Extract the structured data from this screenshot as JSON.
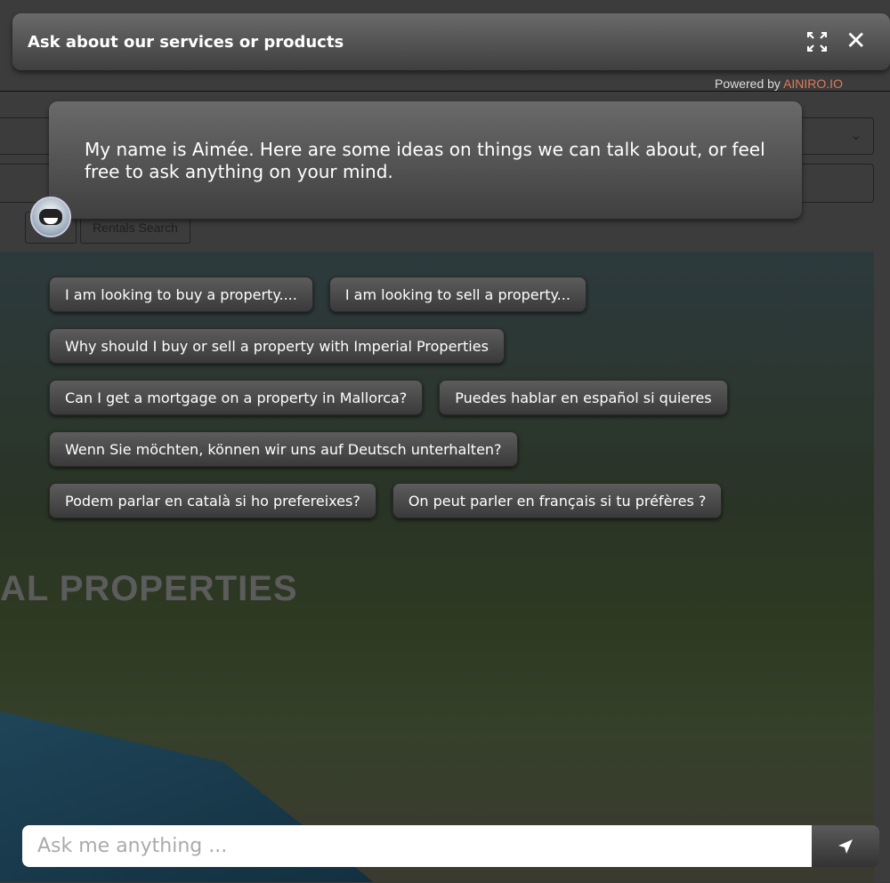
{
  "header": {
    "title": "Ask about our services or products",
    "maximize_icon": "maximize-icon",
    "close_icon": "close-icon"
  },
  "powered_by": {
    "prefix": "Powered by",
    "brand": "AINIRO.IO",
    "brand_color": "#e07a5a"
  },
  "background_site": {
    "button_label": "Rentals Search",
    "hero_title": "AL PROPERTIES"
  },
  "greeting": "My name is Aimée. Here are some ideas on things we can talk about, or feel free to ask anything on your mind.",
  "suggestions": [
    [
      "I am looking to buy a property....",
      "I am looking to sell a property..."
    ],
    [
      "Why should I buy or sell a property with Imperial Properties"
    ],
    [
      "Can I get a mortgage on a property in Mallorca?",
      "Puedes hablar en español si quieres"
    ],
    [
      "Wenn Sie möchten, können wir uns auf Deutsch unterhalten?"
    ],
    [
      "Podem parlar en català si ho prefereixes?",
      "On peut parler en français si tu préfères ?"
    ]
  ],
  "input": {
    "placeholder": "Ask me anything ...",
    "value": ""
  },
  "send_icon": "send-icon"
}
